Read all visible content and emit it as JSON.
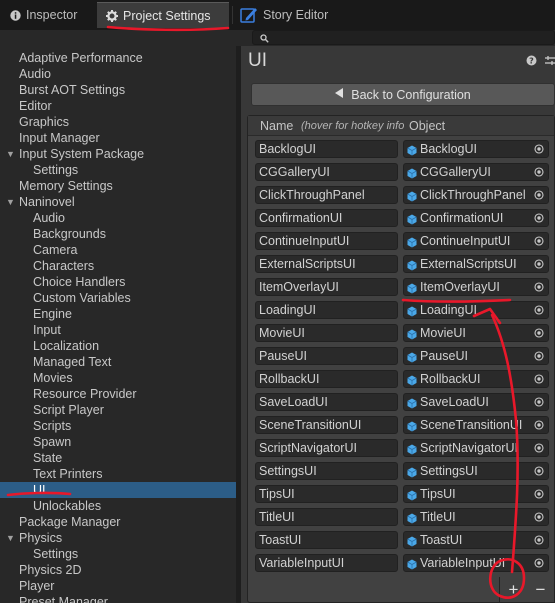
{
  "tabs": [
    {
      "label": "Inspector",
      "icon": "info-icon"
    },
    {
      "label": "Project Settings",
      "icon": "gear-icon"
    },
    {
      "label": "Story Editor",
      "icon": "pen-icon"
    }
  ],
  "search": {
    "placeholder": "",
    "icon": "search-icon"
  },
  "sidebar": {
    "items": [
      {
        "label": "Adaptive Performance",
        "indent": 0,
        "expand": null
      },
      {
        "label": "Audio",
        "indent": 0,
        "expand": null
      },
      {
        "label": "Burst AOT Settings",
        "indent": 0,
        "expand": null
      },
      {
        "label": "Editor",
        "indent": 0,
        "expand": null
      },
      {
        "label": "Graphics",
        "indent": 0,
        "expand": null
      },
      {
        "label": "Input Manager",
        "indent": 0,
        "expand": null
      },
      {
        "label": "Input System Package",
        "indent": 0,
        "expand": "open"
      },
      {
        "label": "Settings",
        "indent": 1,
        "expand": null
      },
      {
        "label": "Memory Settings",
        "indent": 0,
        "expand": null
      },
      {
        "label": "Naninovel",
        "indent": 0,
        "expand": "open"
      },
      {
        "label": "Audio",
        "indent": 1,
        "expand": null
      },
      {
        "label": "Backgrounds",
        "indent": 1,
        "expand": null
      },
      {
        "label": "Camera",
        "indent": 1,
        "expand": null
      },
      {
        "label": "Characters",
        "indent": 1,
        "expand": null
      },
      {
        "label": "Choice Handlers",
        "indent": 1,
        "expand": null
      },
      {
        "label": "Custom Variables",
        "indent": 1,
        "expand": null
      },
      {
        "label": "Engine",
        "indent": 1,
        "expand": null
      },
      {
        "label": "Input",
        "indent": 1,
        "expand": null
      },
      {
        "label": "Localization",
        "indent": 1,
        "expand": null
      },
      {
        "label": "Managed Text",
        "indent": 1,
        "expand": null
      },
      {
        "label": "Movies",
        "indent": 1,
        "expand": null
      },
      {
        "label": "Resource Provider",
        "indent": 1,
        "expand": null
      },
      {
        "label": "Script Player",
        "indent": 1,
        "expand": null
      },
      {
        "label": "Scripts",
        "indent": 1,
        "expand": null
      },
      {
        "label": "Spawn",
        "indent": 1,
        "expand": null
      },
      {
        "label": "State",
        "indent": 1,
        "expand": null
      },
      {
        "label": "Text Printers",
        "indent": 1,
        "expand": null
      },
      {
        "label": "UI",
        "indent": 1,
        "expand": null,
        "selected": true
      },
      {
        "label": "Unlockables",
        "indent": 1,
        "expand": null
      },
      {
        "label": "Package Manager",
        "indent": 0,
        "expand": null
      },
      {
        "label": "Physics",
        "indent": 0,
        "expand": "open"
      },
      {
        "label": "Settings",
        "indent": 1,
        "expand": null
      },
      {
        "label": "Physics 2D",
        "indent": 0,
        "expand": null
      },
      {
        "label": "Player",
        "indent": 0,
        "expand": null
      },
      {
        "label": "Preset Manager",
        "indent": 0,
        "expand": null
      }
    ]
  },
  "main": {
    "title": "UI",
    "help_icon": "help-icon",
    "settings_icon": "sliders-icon",
    "back_button": {
      "label": "Back to Configuration",
      "icon": "triangle-left-icon"
    },
    "list": {
      "col_name": "Name",
      "col_name_hint": "(hover for hotkey info",
      "col_object": "Object",
      "rows": [
        {
          "name": "BacklogUI",
          "object": "BacklogUI"
        },
        {
          "name": "CGGalleryUI",
          "object": "CGGalleryUI"
        },
        {
          "name": "ClickThroughPanel",
          "object": "ClickThroughPanel"
        },
        {
          "name": "ConfirmationUI",
          "object": "ConfirmationUI"
        },
        {
          "name": "ContinueInputUI",
          "object": "ContinueInputUI"
        },
        {
          "name": "ExternalScriptsUI",
          "object": "ExternalScriptsUI"
        },
        {
          "name": "ItemOverlayUI",
          "object": "ItemOverlayUI"
        },
        {
          "name": "LoadingUI",
          "object": "LoadingUI"
        },
        {
          "name": "MovieUI",
          "object": "MovieUI"
        },
        {
          "name": "PauseUI",
          "object": "PauseUI"
        },
        {
          "name": "RollbackUI",
          "object": "RollbackUI"
        },
        {
          "name": "SaveLoadUI",
          "object": "SaveLoadUI"
        },
        {
          "name": "SceneTransitionUI",
          "object": "SceneTransitionUI"
        },
        {
          "name": "ScriptNavigatorUI",
          "object": "ScriptNavigatorUI"
        },
        {
          "name": "SettingsUI",
          "object": "SettingsUI"
        },
        {
          "name": "TipsUI",
          "object": "TipsUI"
        },
        {
          "name": "TitleUI",
          "object": "TitleUI"
        },
        {
          "name": "ToastUI",
          "object": "ToastUI"
        },
        {
          "name": "VariableInputUI",
          "object": "VariableInputUI"
        }
      ]
    },
    "footer": {
      "add_label": "+",
      "remove_label": "−"
    }
  },
  "colors": {
    "selection": "#2c5d87",
    "annotation": "#e8182a",
    "prefab_icon": "#4aa8e8"
  }
}
